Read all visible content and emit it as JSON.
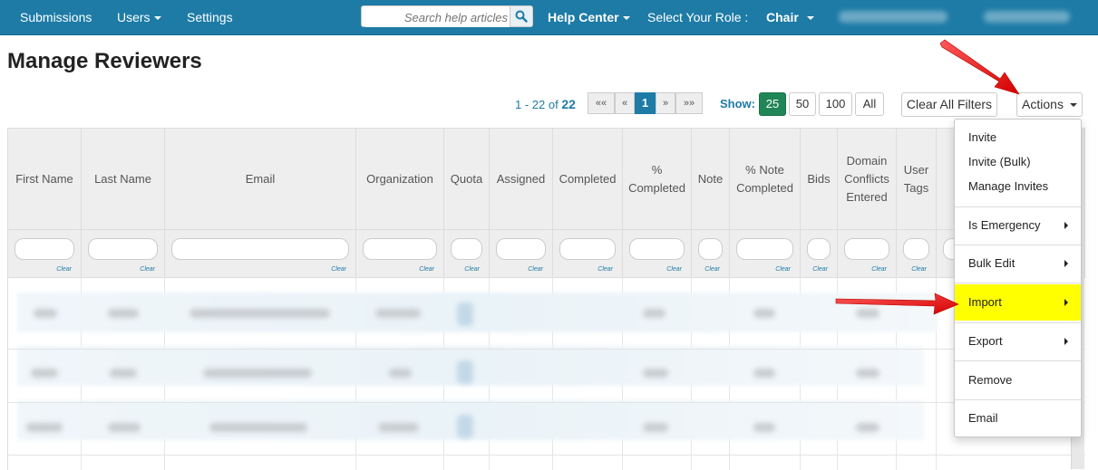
{
  "nav": {
    "items": [
      "Submissions",
      "Users",
      "Settings"
    ],
    "search_placeholder": "Search help articles",
    "help_center": "Help Center",
    "role_label": "Select Your Role :",
    "role_value": "Chair"
  },
  "page": {
    "title": "Manage Reviewers"
  },
  "pager": {
    "range": "1 - 22 of",
    "total": "22",
    "buttons": [
      "««",
      "«",
      "1",
      "»",
      "»»"
    ],
    "current": "1",
    "show_label": "Show:",
    "sizes": [
      "25",
      "50",
      "100",
      "All"
    ],
    "active_size": "25"
  },
  "toolbar": {
    "clear_filters": "Clear All Filters",
    "actions": "Actions"
  },
  "table": {
    "columns": [
      "First Name",
      "Last Name",
      "Email",
      "Organization",
      "Quota",
      "Assigned",
      "Completed",
      "% Completed",
      "Note",
      "% Note Completed",
      "Bids",
      "Domain Conflicts Entered",
      "User Tags"
    ],
    "filter_clear": "Clear"
  },
  "actions_menu": [
    {
      "label": "Invite",
      "submenu": false
    },
    {
      "label": "Invite (Bulk)",
      "submenu": false
    },
    {
      "label": "Manage Invites",
      "submenu": false
    },
    {
      "label": "Is Emergency",
      "submenu": true
    },
    {
      "label": "Bulk Edit",
      "submenu": true
    },
    {
      "label": "Import",
      "submenu": true,
      "highlighted": true
    },
    {
      "label": "Export",
      "submenu": true
    },
    {
      "label": "Remove",
      "submenu": false
    },
    {
      "label": "Email",
      "submenu": false
    }
  ],
  "colors": {
    "nav_bg": "#1d7ba6",
    "active_size": "#218657",
    "highlight": "#ffff00",
    "arrow": "#ee1c1c"
  }
}
